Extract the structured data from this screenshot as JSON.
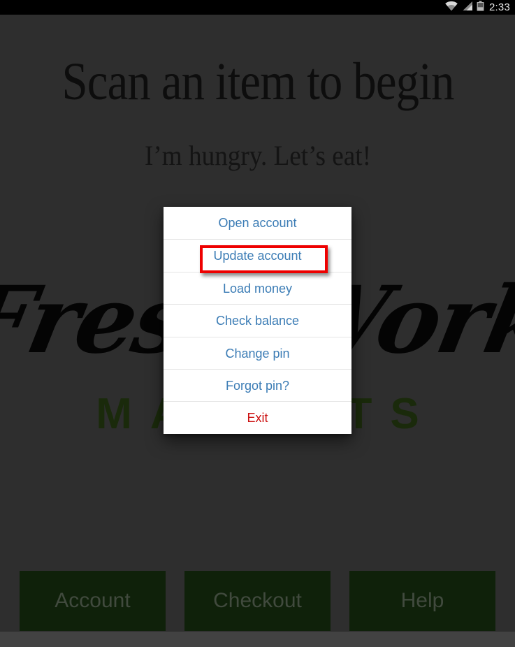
{
  "status_bar": {
    "clock": "2:33",
    "icons": [
      "wifi-icon",
      "cellular-signal-icon",
      "battery-icon"
    ]
  },
  "background": {
    "headline": "Scan an item to begin",
    "subhead": "I’m hungry. Let’s eat!",
    "logo_script": "Fresh Work",
    "logo_markets": "MARKETS"
  },
  "bottom_nav": {
    "buttons": [
      {
        "label": "Account",
        "name": "account-button"
      },
      {
        "label": "Checkout",
        "name": "checkout-button"
      },
      {
        "label": "Help",
        "name": "help-button"
      }
    ]
  },
  "dialog": {
    "items": [
      {
        "label": "Open account",
        "style": "normal",
        "highlighted": false
      },
      {
        "label": "Update account",
        "style": "normal",
        "highlighted": true
      },
      {
        "label": "Load money",
        "style": "normal",
        "highlighted": false
      },
      {
        "label": "Check balance",
        "style": "normal",
        "highlighted": false
      },
      {
        "label": "Change pin",
        "style": "normal",
        "highlighted": false
      },
      {
        "label": "Forgot pin?",
        "style": "normal",
        "highlighted": false
      },
      {
        "label": "Exit",
        "style": "danger",
        "highlighted": false
      }
    ]
  },
  "colors": {
    "screen_background": "#424242",
    "status_bar": "#000000",
    "dialog_background": "#ffffff",
    "menu_text": "#3b7cb5",
    "exit_text": "#cc1111",
    "highlight_border": "#ee0000",
    "button_background": "#16300f",
    "button_text": "#5d6b59",
    "markets_green": "#263d10",
    "separator": "#e4e4e4"
  }
}
